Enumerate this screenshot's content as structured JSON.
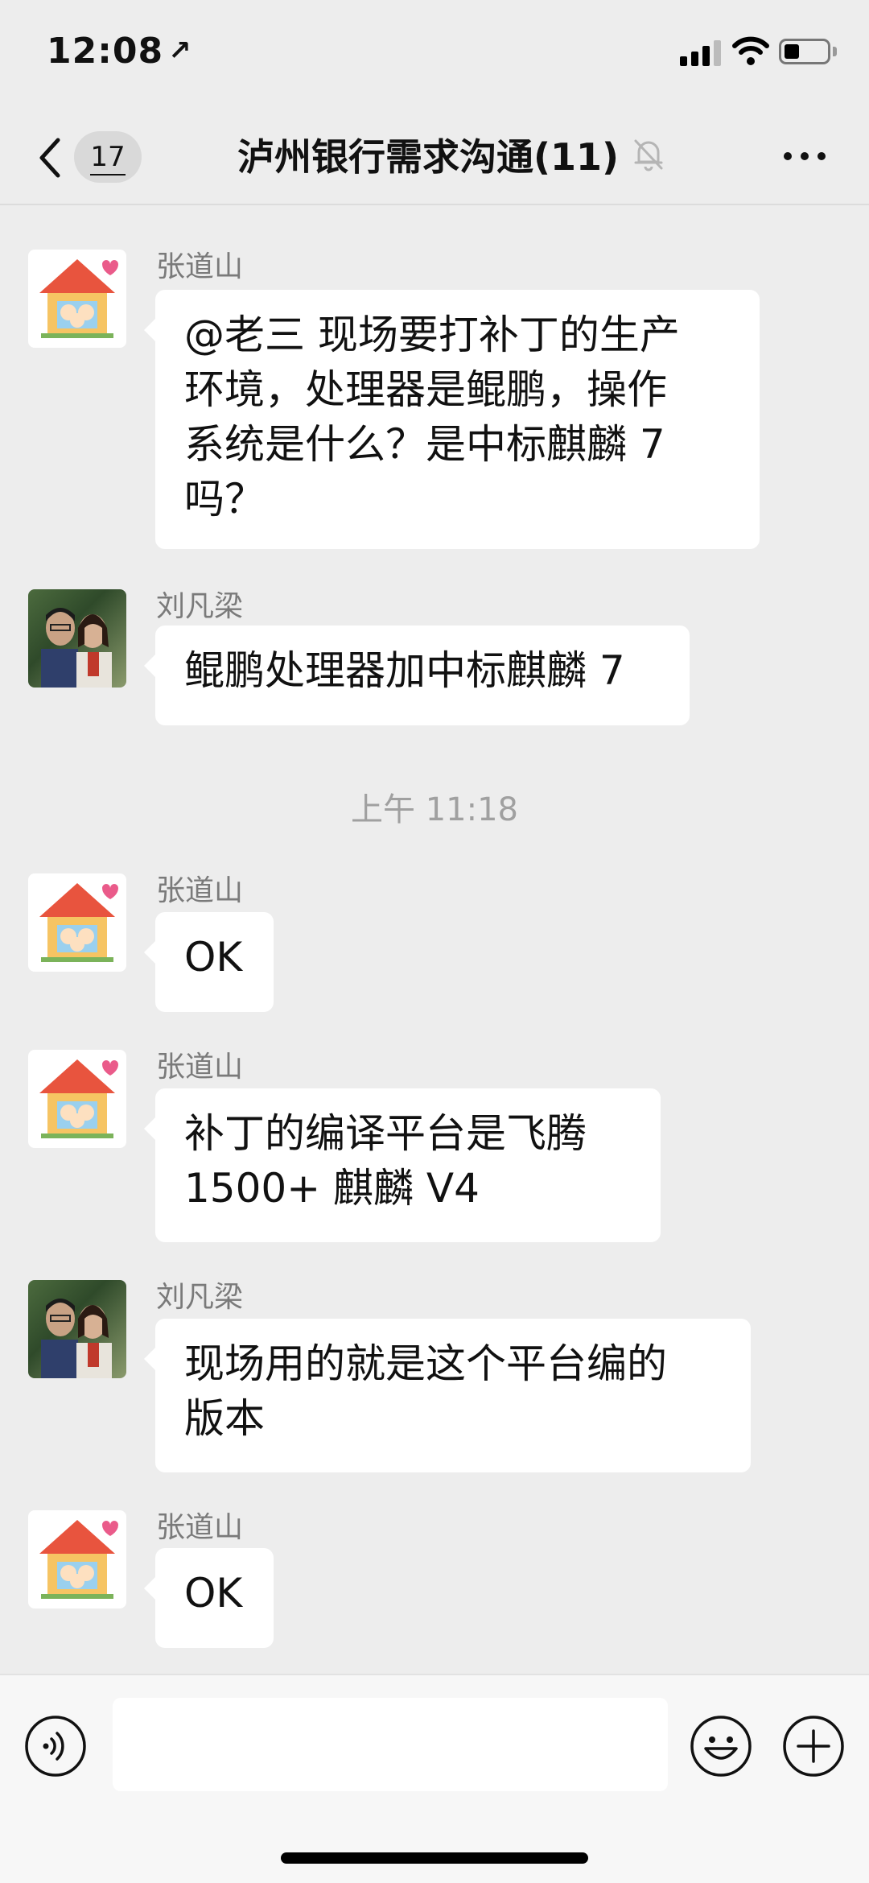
{
  "status_bar": {
    "time": "12:08",
    "location_arrow": "↗"
  },
  "nav": {
    "back_icon": "chevron-left-icon",
    "unread_count": "17",
    "title": "泸州银行需求沟通(11)",
    "mute_icon": "bell-muted-icon",
    "more_icon": "more-horizontal-icon"
  },
  "messages": [
    {
      "sender": "张道山",
      "avatar": "house-cartoon-avatar",
      "text": "@老三 现场要打补丁的生产\n环境，处理器是鲲鹏，操作\n系统是什么？是中标麒麟 7\n吗？"
    },
    {
      "sender": "刘凡梁",
      "avatar": "couple-photo-avatar",
      "text": "鲲鹏处理器加中标麒麟 7"
    },
    {
      "sender": "张道山",
      "avatar": "house-cartoon-avatar",
      "text": "OK"
    },
    {
      "sender": "张道山",
      "avatar": "house-cartoon-avatar",
      "text": "补丁的编译平台是飞腾\n1500+ 麒麟 V4"
    },
    {
      "sender": "刘凡梁",
      "avatar": "couple-photo-avatar",
      "text": "现场用的就是这个平台编的\n版本"
    },
    {
      "sender": "张道山",
      "avatar": "house-cartoon-avatar",
      "text": "OK"
    }
  ],
  "time_divider": "上午 11:18",
  "input_bar": {
    "voice_icon": "voice-icon",
    "input_value": "",
    "emoji_icon": "emoji-icon",
    "plus_icon": "plus-circle-icon"
  },
  "colors": {
    "background": "#ededed",
    "bubble": "#ffffff",
    "sender_text": "#7a7a7a",
    "time_divider_text": "#a0a0a0"
  }
}
